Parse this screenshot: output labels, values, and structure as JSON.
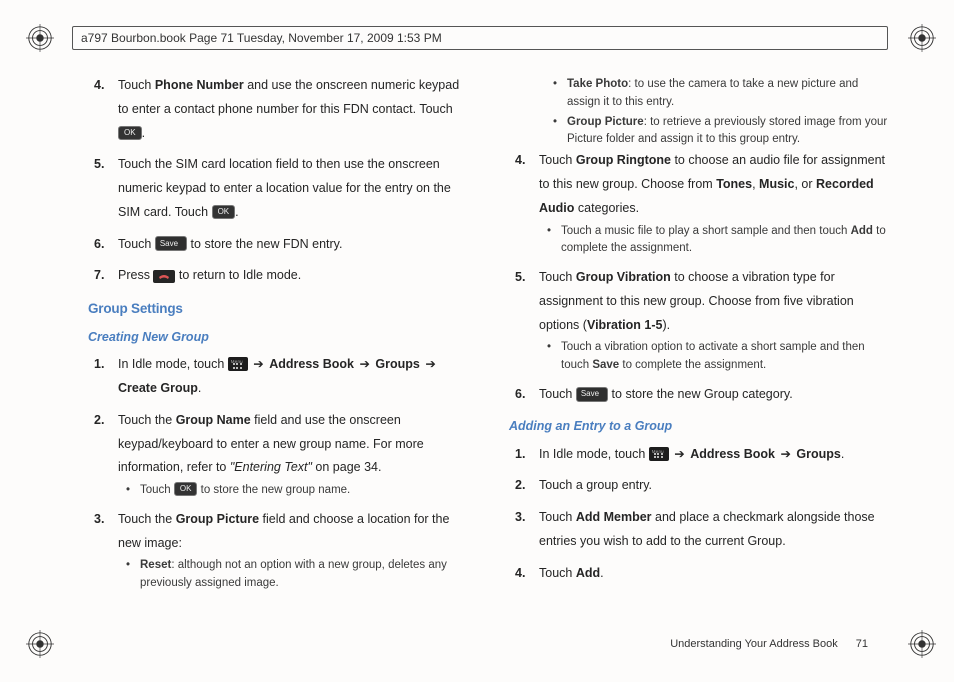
{
  "header": {
    "runningHead": "a797 Bourbon.book  Page 71  Tuesday, November 17, 2009  1:53 PM"
  },
  "buttons": {
    "ok": "OK",
    "save": "Save"
  },
  "left": {
    "s4a": "Touch ",
    "s4b": "Phone Number",
    "s4c": " and use the onscreen numeric keypad to enter a contact phone number for this FDN contact. Touch ",
    "s4d": ".",
    "s5a": "Touch the SIM card location field to then use the onscreen numeric keypad to enter a location value for the entry on the SIM card. Touch ",
    "s5b": ".",
    "s6a": "Touch ",
    "s6b": " to store the new FDN entry.",
    "s7a": "Press ",
    "s7b": " to return to Idle mode.",
    "h1": "Group Settings",
    "h2": "Creating New Group",
    "g1a": "In Idle mode, touch ",
    "g1b": " ➔ ",
    "g1c": "Address Book",
    "g1d": "Groups",
    "g1e": "Create Group",
    "g1f": ".",
    "g2a": "Touch the ",
    "g2b": "Group Name",
    "g2c": " field and use the onscreen keypad/keyboard to enter a new group name. For more information, refer to ",
    "g2d": "\"Entering Text\"",
    "g2e": "  on page 34.",
    "g2sub_a": "Touch ",
    "g2sub_b": " to store the new group name.",
    "g3a": "Touch the ",
    "g3b": "Group Picture",
    "g3c": " field and choose a location for the new image:",
    "g3sub1a": "Reset",
    "g3sub1b": ": although not an option with a new group, deletes any previously assigned image."
  },
  "right": {
    "r_sub1a": "Take Photo",
    "r_sub1b": ": to use the camera to take a new picture and assign it to this entry.",
    "r_sub2a": "Group Picture",
    "r_sub2b": ": to retrieve a previously stored image from your Picture folder and assign it to this group entry.",
    "r4a": "Touch ",
    "r4b": "Group Ringtone",
    "r4c": " to choose an audio file for assignment to this new group. Choose from ",
    "r4d": "Tones",
    "r4e": "Music",
    "r4f": "Recorded Audio",
    "r4g": " categories.",
    "r4sub_a": "Touch a music file to play a short sample and then touch ",
    "r4sub_b": "Add",
    "r4sub_c": " to complete the assignment.",
    "r5a": "Touch ",
    "r5b": "Group Vibration",
    "r5c": " to choose a vibration type for assignment to this new group. Choose from five vibration options (",
    "r5d": "Vibration 1-5",
    "r5e": ").",
    "r5sub_a": "Touch a vibration option to activate a short sample and then touch ",
    "r5sub_b": "Save",
    "r5sub_c": " to complete the assignment.",
    "r6a": "Touch ",
    "r6b": " to store the new Group category.",
    "h3": "Adding an Entry to a Group",
    "a1a": "In Idle mode, touch ",
    "a1b": "Address Book",
    "a1c": "Groups",
    "a1d": ".",
    "a2": "Touch a group entry.",
    "a3a": "Touch ",
    "a3b": "Add Member",
    "a3c": " and place a checkmark alongside those entries you wish to add to the current Group.",
    "a4a": "Touch ",
    "a4b": "Add",
    "a4c": "."
  },
  "nums": {
    "n1": "1.",
    "n2": "2.",
    "n3": "3.",
    "n4": "4.",
    "n5": "5.",
    "n6": "6.",
    "n7": "7."
  },
  "footer": {
    "section": "Understanding Your Address Book",
    "page": "71"
  }
}
